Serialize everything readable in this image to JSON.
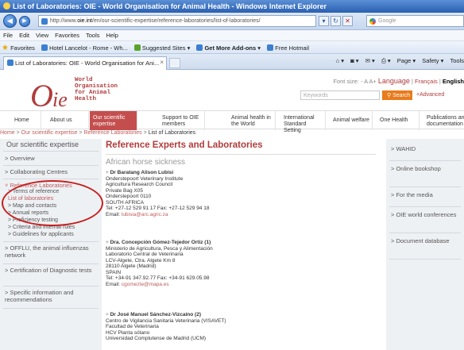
{
  "window": {
    "title": "List of Laboratories: OIE - World Organisation for Animal Health - Windows Internet Explorer"
  },
  "address": {
    "url_prefix": "http://www.",
    "url_host": "oie.int",
    "url_path": "/en/our-scientific-expertise/reference-laboratories/list-of-laboratories/",
    "search_placeholder": "Google"
  },
  "menu": [
    "File",
    "Edit",
    "View",
    "Favorites",
    "Tools",
    "Help"
  ],
  "favorites": {
    "label": "Favorites",
    "items": [
      "Hotel Lancelot - Rome - Wh...",
      "Suggested Sites ▾",
      "Get More Add-ons ▾",
      "Free Hotmail"
    ]
  },
  "tab": {
    "title": "List of Laboratories: OIE - World Organisation for Ani..."
  },
  "command_bar": [
    "Page ▾",
    "Safety ▾",
    "Tools"
  ],
  "site": {
    "logo_text": [
      "World",
      "Organisation",
      "for Animal",
      "Health"
    ],
    "font_size_label": "Font size: ",
    "font_size_controls": "- A A+",
    "language_label": "Language",
    "lang_fr": "Français",
    "lang_en": "English",
    "keywords_placeholder": "Keywords",
    "search_button": "Search",
    "advanced": "+Advanced"
  },
  "nav": [
    "Home",
    "About us",
    "Our scientific expertise",
    "Support to OIE members",
    "Animal health in the World",
    "International Standard Setting",
    "Animal welfare",
    "One Health",
    "Publications and documentation"
  ],
  "breadcrumb": {
    "home": "Home",
    "sep": " > ",
    "l1": "Our scientific expertise",
    "l2": "Reference Laboratories",
    "current": "List of Laboratories"
  },
  "left": {
    "title": "Our scientific expertise",
    "overview": "Overview",
    "collab": "Collaborating Centres",
    "reflabs": "Reference Laboratories",
    "terms": "Terms of reference",
    "list": "List of laboratories",
    "map": "Map and contacts",
    "annual": "Annual reports",
    "proficiency": "Proficiency testing",
    "criteria": "Criteria and internal rules",
    "guidelines": "Guidelines for applicants",
    "offlu": "OFFLU, the animal influenzas network",
    "cert": "Certification of Diagnostic tests",
    "specific": "Specific information and recommendations"
  },
  "main": {
    "heading": "Reference Experts and Laboratories",
    "disease": "African horse sickness",
    "experts": [
      {
        "name": "Dr Baratang Alison Lubisi",
        "lines": [
          "Onderstepoort Veterinary Institute",
          "Agricultura Research Council",
          "Private Bag X05",
          "Onderstepoort 0110",
          "SOUTH AFRICA",
          "Tel: +27-12 529 91 17   Fax: +27-12 529 94 18"
        ],
        "email_label": "Email: ",
        "email": "lubisia@arc.agric.za"
      },
      {
        "name": "Dra. Concepción Gómez-Tejedor Ortiz (1)",
        "lines": [
          "Ministerio de Agricultura, Pesca y Alimentación",
          "Laboratorio Central de Veterinaria",
          "LCV-Algete, Ctra. Algete Km 8",
          "28110 Algete (Madrid)",
          "SPAIN",
          "Tel: +34-91 347.92.77   Fax: +34-91 629.05.98"
        ],
        "email_label": "Email: ",
        "email": "cgomezte@mapa.es"
      },
      {
        "name": "Dr José Manuel Sánchez-Vizcaíno (2)",
        "lines": [
          "Centro de Vigilancia Sanitaria Veterinaria (VISAVET)",
          "Facultad de Veterinaria",
          "HCV Planta sótano",
          "Universidad Complutense de Madrid (UCM)"
        ],
        "email_label": "",
        "email": ""
      }
    ]
  },
  "right": [
    "WAHID",
    "Online bookshop",
    "For the media",
    "OIE world conferences",
    "Document database"
  ]
}
